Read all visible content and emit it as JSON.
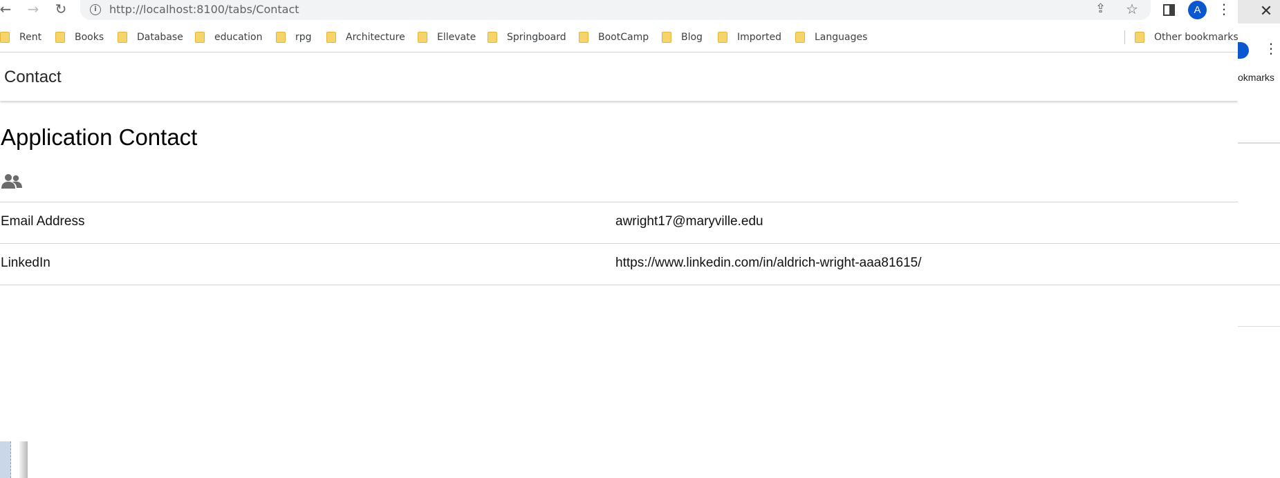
{
  "browser": {
    "url": "http://localhost:8100/tabs/Contact",
    "avatar_letter": "A",
    "bookmarks": [
      "Rent",
      "Books",
      "Database",
      "education",
      "rpg",
      "Architecture",
      "Ellevate",
      "Springboard",
      "BootCamp",
      "Blog",
      "Imported",
      "Languages"
    ],
    "other_bookmarks": "Other bookmarks"
  },
  "ghost_window": {
    "bookmarks_fragment": "okmarks",
    "close_glyph": "✕"
  },
  "app": {
    "header_title": "Contact",
    "page_heading": "Application Contact",
    "contacts": [
      {
        "label": "Email Address",
        "value": "awright17@maryville.edu"
      },
      {
        "label": "LinkedIn",
        "value": "https://www.linkedin.com/in/aldrich-wright-aaa81615/"
      }
    ]
  },
  "colors": {
    "avatar": "#0b57d0",
    "folder": "#f6d36b",
    "icon": "#6b6b6b"
  }
}
